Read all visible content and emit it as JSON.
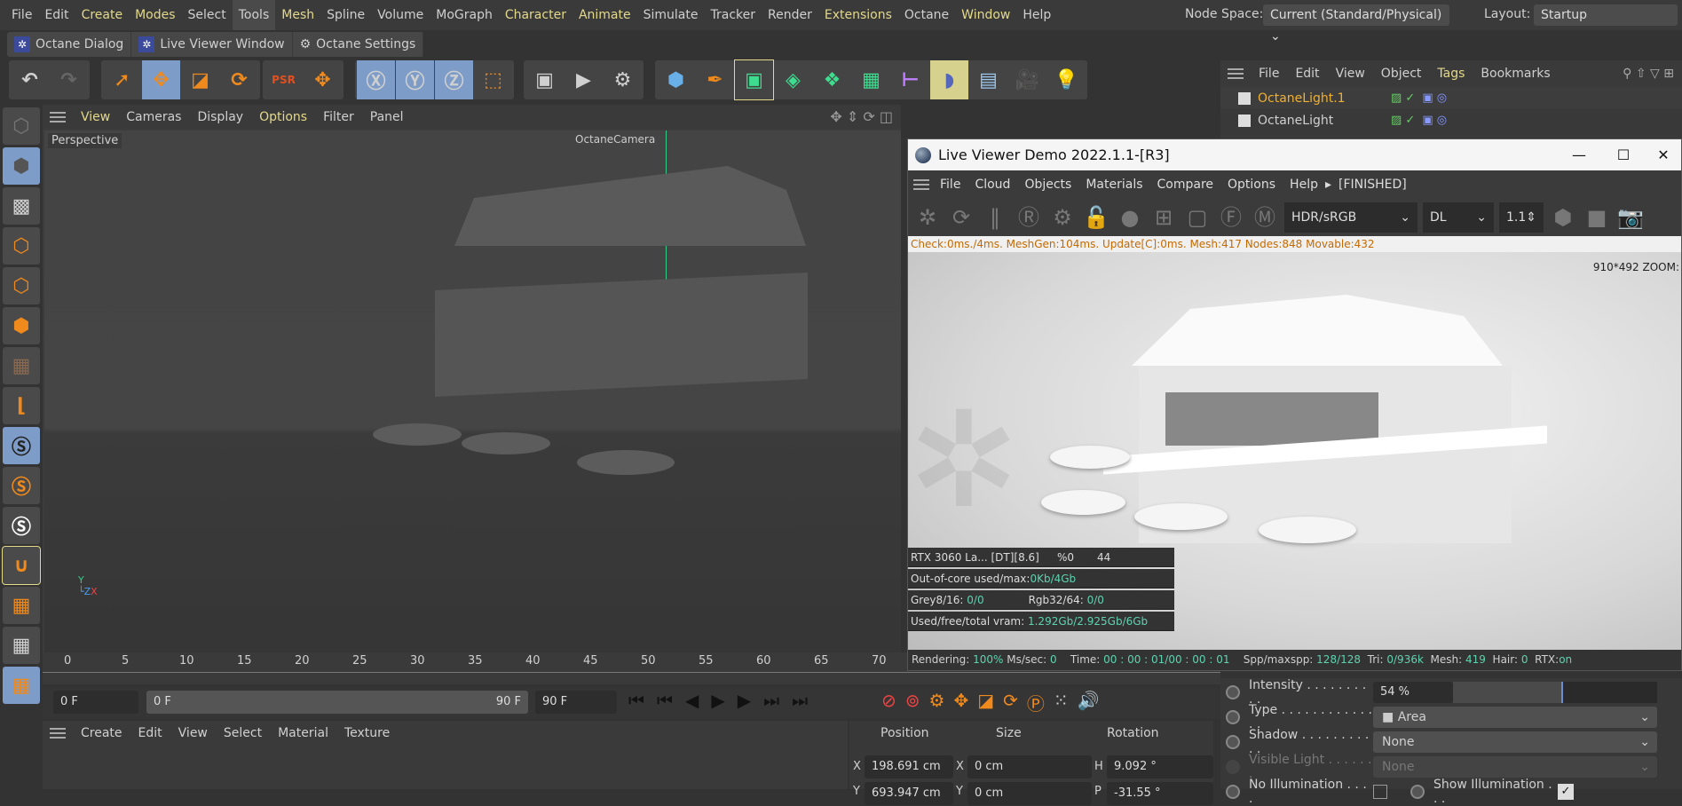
{
  "menubar": {
    "items": [
      "File",
      "Edit",
      "Create",
      "Modes",
      "Select",
      "Tools",
      "Mesh",
      "Spline",
      "Volume",
      "MoGraph",
      "Character",
      "Animate",
      "Simulate",
      "Tracker",
      "Render",
      "Extensions",
      "Octane",
      "Window",
      "Help"
    ],
    "node_space_label": "Node Space:",
    "node_space_value": "Current (Standard/Physical)",
    "layout_label": "Layout:",
    "layout_value": "Startup"
  },
  "octane_bar": {
    "dialog": "Octane Dialog",
    "live_viewer": "Live Viewer Window",
    "settings": "Octane Settings"
  },
  "viewport": {
    "menu": [
      "View",
      "Cameras",
      "Display",
      "Options",
      "Filter",
      "Panel"
    ],
    "view_name": "Perspective",
    "camera_label": "OctaneCamera"
  },
  "object_manager": {
    "menu": [
      "File",
      "Edit",
      "View",
      "Object",
      "Tags",
      "Bookmarks"
    ],
    "objects": [
      {
        "name": "OctaneLight.1",
        "selected": true
      },
      {
        "name": "OctaneLight",
        "selected": false
      }
    ]
  },
  "live_viewer": {
    "title": "Live Viewer Demo 2022.1.1-[R3]",
    "menu": [
      "File",
      "Cloud",
      "Objects",
      "Materials",
      "Compare",
      "Options",
      "Help"
    ],
    "state": "[FINISHED]",
    "tonemap": "HDR/sRGB",
    "kernel": "DL",
    "gamma": "1.1",
    "info": "Check:0ms./4ms. MeshGen:104ms. Update[C]:0ms. Mesh:417 Nodes:848 Movable:432",
    "resolution": "910*492 ZOOM:",
    "gpu": "RTX 3060 La... [DT][8.6]",
    "gpu_pct": "%0",
    "gpu_temp": "44",
    "ooc_label": "Out-of-core used/max:",
    "ooc_value": "0Kb/4Gb",
    "grey_label": "Grey8/16: ",
    "grey_value": "0/0",
    "rgb_label": "Rgb32/64: ",
    "rgb_value": "0/0",
    "vram_label": "Used/free/total vram: ",
    "vram_value": "1.292Gb/2.925Gb/6Gb",
    "status": {
      "rendering_label": "Rendering: ",
      "rendering": "100%",
      "ms_label": " Ms/sec: ",
      "ms": "0",
      "time_label": "Time: ",
      "time": "00 : 00 : 01/00 : 00 : 01",
      "spp_label": "Spp/maxspp: ",
      "spp": "128/128",
      "tri_label": "Tri: ",
      "tri": "0/936k",
      "mesh_label": "Mesh: ",
      "mesh": "419",
      "hair_label": "Hair: ",
      "hair": "0",
      "rtx_label": "RTX:",
      "rtx": "on"
    }
  },
  "timeline": {
    "ticks": [
      "0",
      "5",
      "10",
      "15",
      "20",
      "25",
      "30",
      "35",
      "40",
      "45",
      "50",
      "55",
      "60",
      "65",
      "70"
    ],
    "current": "0 F",
    "range_start": "0 F",
    "range_end": "90 F",
    "end": "90 F"
  },
  "material_manager": {
    "menu": [
      "Create",
      "Edit",
      "View",
      "Select",
      "Material",
      "Texture"
    ]
  },
  "coordinates": {
    "headers": [
      "Position",
      "Size",
      "Rotation"
    ],
    "rows": [
      {
        "axis": "X",
        "pos": "198.691 cm",
        "size_axis": "X",
        "size": "0 cm",
        "rot_axis": "H",
        "rot": "9.092 °"
      },
      {
        "axis": "Y",
        "pos": "693.947 cm",
        "size_axis": "Y",
        "size": "0 cm",
        "rot_axis": "P",
        "rot": "-31.55 °"
      }
    ]
  },
  "attributes": {
    "intensity_label": "Intensity . . . . . . . . . .",
    "intensity": "54 %",
    "intensity_fraction": 0.54,
    "type_label": "Type . . . . . . . . . . . . . .",
    "type": "Area",
    "shadow_label": "Shadow . . . . . . . . . . .",
    "shadow": "None",
    "visible_label": "Visible Light . . . . . . .",
    "visible": "None",
    "noillum_label": "No Illumination . . . .",
    "showillum_label": "Show Illumination . . .",
    "show_illumination": true,
    "no_illumination": false
  }
}
